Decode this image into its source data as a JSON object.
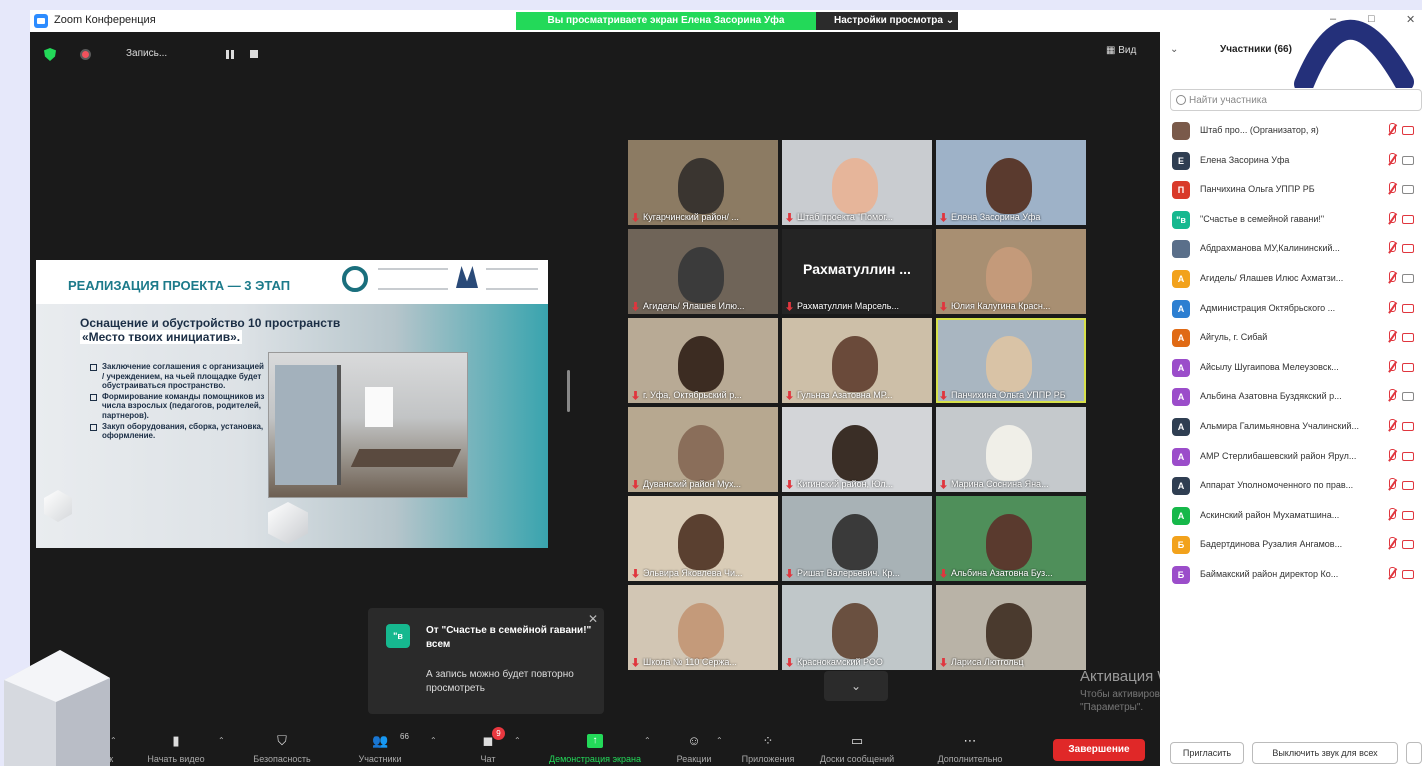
{
  "window": {
    "title": "Zoom Конференция",
    "share_banner": "Вы просматриваете экран Елена Засорина Уфа",
    "view_options": "Настройки просмотра ⌄",
    "minimize": "–",
    "maximize": "□",
    "close": "✕"
  },
  "recording": {
    "label": "Запись..."
  },
  "view_button": "▦ Вид",
  "slide": {
    "title": "РЕАЛИЗАЦИЯ ПРОЕКТА — 3 ЭТАП",
    "heading_line1": "Оснащение и обустройство 10 пространств",
    "heading_line2": "«Место твоих инициатив».",
    "bullets": [
      "Заключение соглашения с организацией / учреждением, на чьей площадке будет обустраиваться пространство.",
      "Формирование команды помощников из числа взрослых (педагогов, родителей, партнеров).",
      "Закуп оборудования, сборка, установка, оформление."
    ]
  },
  "tiles": [
    "Кугарчинский район/ ...",
    "Штаб проекта \"Помог...",
    "Елена Засорина Уфа",
    "Агидель/ Ялашев Илю...",
    "Рахматуллин Марсель...",
    "Юлия Калугина Красн...",
    "г. Уфа, Октябрьский р...",
    "Гульназ Азатовна  МР...",
    "Панчихина Ольга УППР РБ",
    "Дуванский район Мух...",
    "Кигинский район, Юл...",
    "Марина Соснина Яна...",
    "Эльвира Яковлева Чи...",
    "Ришат Валерьевич. Кр...",
    "Альбина Азатовна Буз...",
    "Школа № 110 Сержа...",
    "Краснокамский РОО",
    "Лариса Лютгольц"
  ],
  "tile_center_name": "Рахматуллин ...",
  "gallery_more": "⌄",
  "chat_toast": {
    "avatar": "\"в",
    "sender": "От \"Счастье в семейной гавани!\" всем",
    "message": "А запись можно будет повторно просмотреть",
    "close": "✕"
  },
  "win_activation": {
    "title": "Активация Windows",
    "line1": "Чтобы активировать Windows, перейдите в раздел",
    "line2": "\"Параметры\"."
  },
  "toolbar": {
    "audio": "Звук",
    "video": "Начать видео",
    "security": "Безопасность",
    "participants": "Участники",
    "participants_count": "66",
    "chat": "Чат",
    "chat_badge": "9",
    "share": "Демонстрация экрана",
    "reactions": "Реакции",
    "apps": "Приложения",
    "whiteboards": "Доски сообщений",
    "more": "Дополнительно",
    "end": "Завершение"
  },
  "panel": {
    "title": "Участники (66)",
    "search_placeholder": "Найти участника",
    "participants": [
      {
        "initial": "",
        "name": "Штаб про...  (Организатор, я)",
        "color": "#7a5a4a",
        "cam_on": false
      },
      {
        "initial": "Е",
        "name": "Елена Засорина Уфа",
        "color": "#2f3e52",
        "cam_on": true
      },
      {
        "initial": "П",
        "name": "Панчихина Ольга УППР РБ",
        "color": "#d93a2a",
        "cam_on": true
      },
      {
        "initial": "\"в",
        "name": "\"Счастье в семейной гавани!\"",
        "color": "#16b88f",
        "cam_on": false
      },
      {
        "initial": "",
        "name": "Абдрахманова МУ,Калининский...",
        "color": "#5a6f8a",
        "cam_on": false
      },
      {
        "initial": "А",
        "name": "Агидель/ Ялашев Илюс Ахматзи...",
        "color": "#f2a21c",
        "cam_on": true
      },
      {
        "initial": "А",
        "name": "Администрация Октябрьского ...",
        "color": "#2d7fd1",
        "cam_on": false
      },
      {
        "initial": "А",
        "name": "Айгуль, г. Сибай",
        "color": "#e06a15",
        "cam_on": false
      },
      {
        "initial": "А",
        "name": "Айсылу Шугаипова Мелеузовск...",
        "color": "#9b4dca",
        "cam_on": false
      },
      {
        "initial": "А",
        "name": "Альбина Азатовна Буздякский р...",
        "color": "#9b4dca",
        "cam_on": true
      },
      {
        "initial": "А",
        "name": "Альмира Галимьяновна Учалинский...",
        "color": "#2f3e52",
        "cam_on": false
      },
      {
        "initial": "А",
        "name": "АМР Стерлибашевский район Ярул...",
        "color": "#9b4dca",
        "cam_on": false
      },
      {
        "initial": "А",
        "name": "Аппарат Уполномоченного по прав...",
        "color": "#2f3e52",
        "cam_on": false
      },
      {
        "initial": "А",
        "name": "Аскинский район Мухаматшина...",
        "color": "#16b84a",
        "cam_on": false
      },
      {
        "initial": "Б",
        "name": "Бадертдинова Рузалия Ангамов...",
        "color": "#f2a21c",
        "cam_on": false
      },
      {
        "initial": "Б",
        "name": "Баймакский район директор Ко...",
        "color": "#9b4dca",
        "cam_on": false
      }
    ],
    "invite": "Пригласить",
    "mute_all": "Выключить звук для всех"
  }
}
